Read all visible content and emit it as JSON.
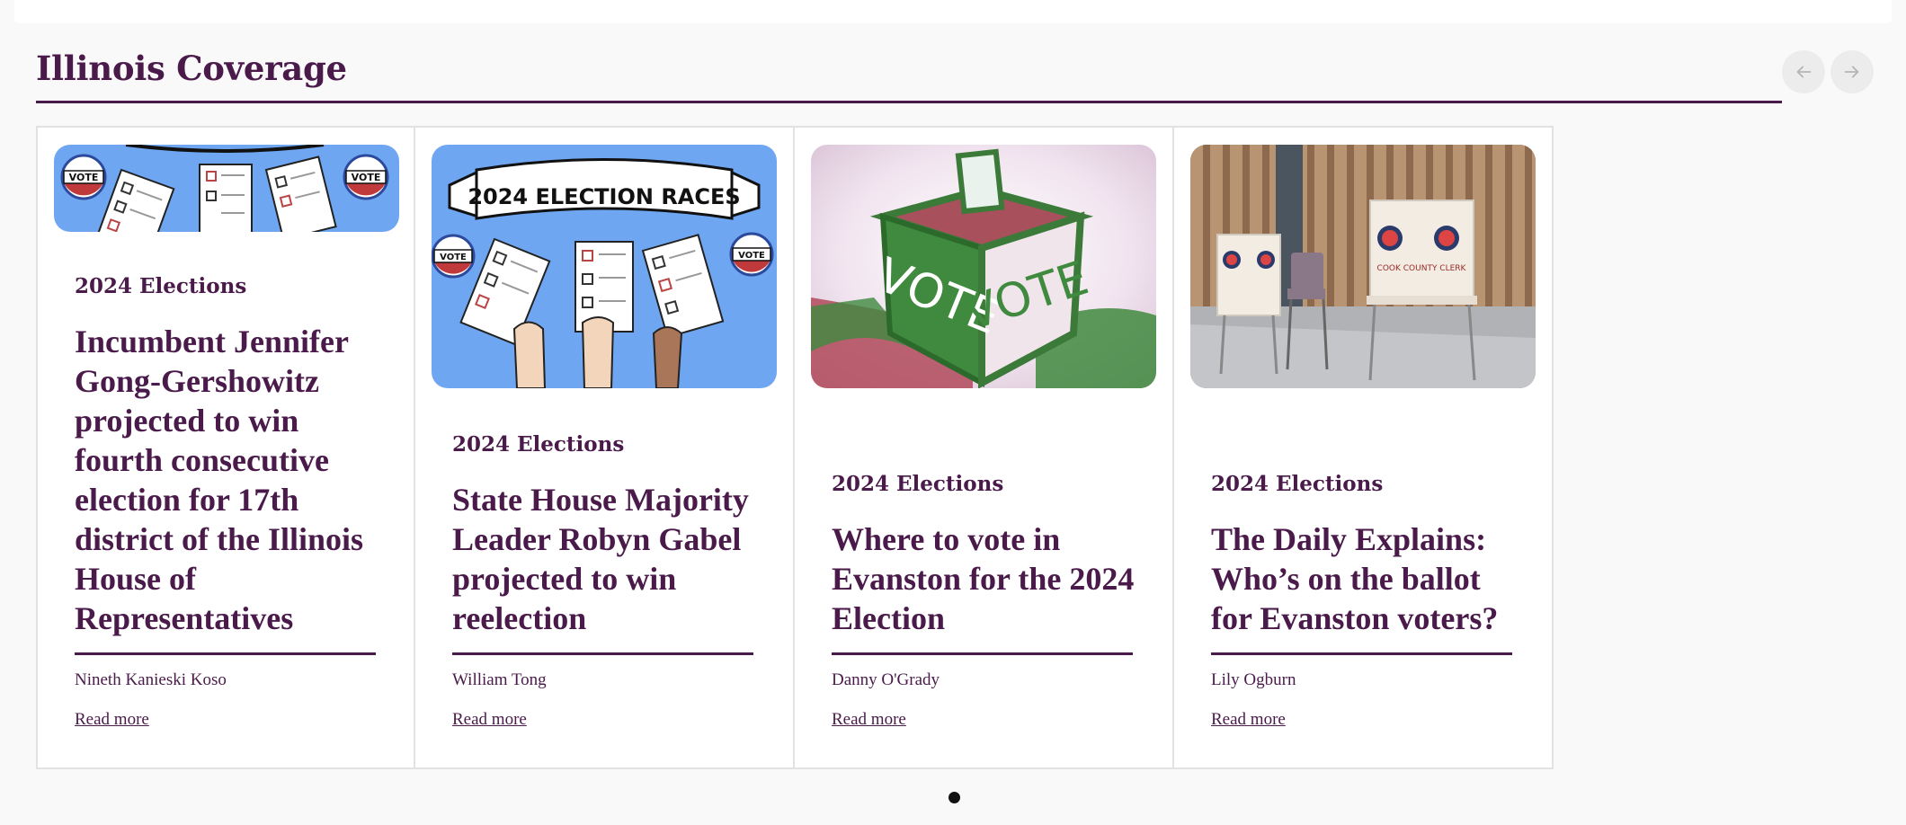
{
  "section": {
    "title": "Illinois Coverage"
  },
  "carousel": {
    "prev_icon": "arrow-left-icon",
    "next_icon": "arrow-right-icon",
    "pagination_dots": 1,
    "active_dot": 1
  },
  "cards": [
    {
      "kicker": "2024 Elections",
      "headline": "Incumbent Jennifer Gong-Gershowitz projected to win fourth consecutive election for 17th district of the Illinois House of Representatives",
      "author": "Nineth Kanieski Koso",
      "read_more": "Read more",
      "image_badge": "VOTE"
    },
    {
      "kicker": "2024 Elections",
      "headline": "State House Majority Leader Robyn Gabel projected to win reelection",
      "author": "William Tong",
      "read_more": "Read more",
      "image_banner": "2024 ELECTION RACES",
      "image_badge": "VOTE"
    },
    {
      "kicker": "2024 Elections",
      "headline": "Where to vote in Evanston for the 2024 Election",
      "author": "Danny O'Grady",
      "read_more": "Read more",
      "image_box_text": "VOTE"
    },
    {
      "kicker": "2024 Elections",
      "headline": "The Daily Explains: Who’s on the ballot for Evanston voters?",
      "author": "Lily Ogburn",
      "read_more": "Read more",
      "image_booth_text": "COOK COUNTY CLERK"
    }
  ],
  "colors": {
    "brand": "#4a1a4a",
    "image_blue": "#6fa6f2",
    "page_bg": "#f9f9f9"
  }
}
